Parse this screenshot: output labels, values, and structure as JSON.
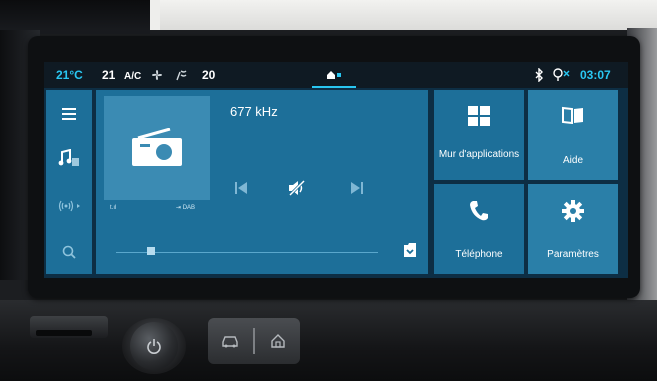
{
  "status_bar": {
    "temp_left": "21°C",
    "zone_left": "21",
    "ac_label": "A/C",
    "zone_right": "20",
    "time": "03:07"
  },
  "nav": {
    "items": [
      {
        "name": "menu-icon"
      },
      {
        "name": "media-source-icon"
      },
      {
        "name": "radio-wave-icon"
      },
      {
        "name": "search-icon"
      }
    ]
  },
  "radio": {
    "frequency": "677 kHz",
    "signal_label": "t.ıl",
    "dab_label": "⇥ DAB",
    "volume_level": 0.12
  },
  "tiles": {
    "apps": {
      "label": "Mur d'applications"
    },
    "help": {
      "label": "Aide"
    },
    "phone": {
      "label": "Téléphone"
    },
    "settings": {
      "label": "Paramètres"
    }
  },
  "colors": {
    "accent": "#29c7f2",
    "tile": "#1d6f99",
    "tile_alt": "#2a7fa8"
  }
}
